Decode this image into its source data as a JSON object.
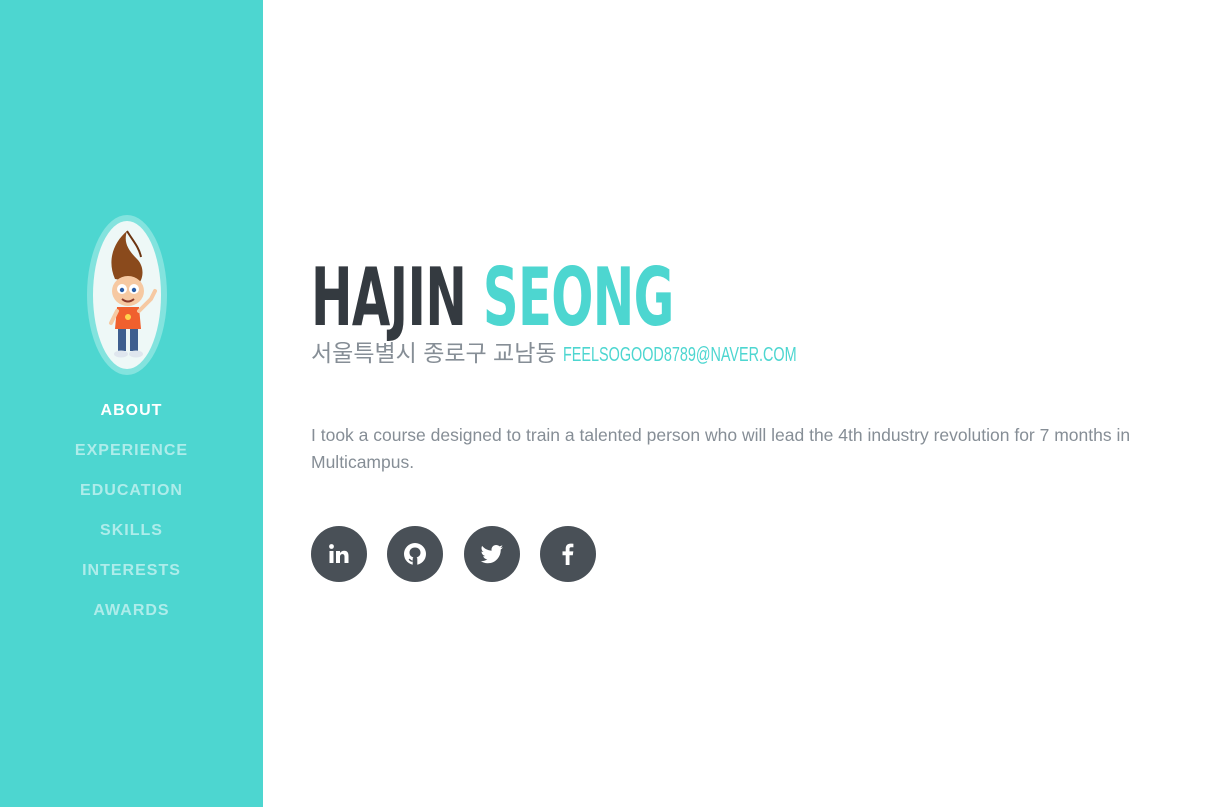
{
  "profile": {
    "first_name": "HAJIN",
    "last_name": "SEONG",
    "address": "서울특별시 종로구 교남동",
    "email": "feelsogood8789@naver.com",
    "bio": "I took a course designed to train a talented person who will lead the 4th industry revolution for 7 months in Multicampus."
  },
  "nav": {
    "items": [
      {
        "label": "ABOUT"
      },
      {
        "label": "EXPERIENCE"
      },
      {
        "label": "EDUCATION"
      },
      {
        "label": "SKILLS"
      },
      {
        "label": "INTERESTS"
      },
      {
        "label": "AWARDS"
      }
    ]
  },
  "social": {
    "icons": [
      "linkedin-icon",
      "github-icon",
      "twitter-icon",
      "facebook-icon"
    ]
  },
  "colors": {
    "accent": "#4dd6d0",
    "heading": "#343a40",
    "text": "#868e96",
    "social_bg": "#495057"
  }
}
